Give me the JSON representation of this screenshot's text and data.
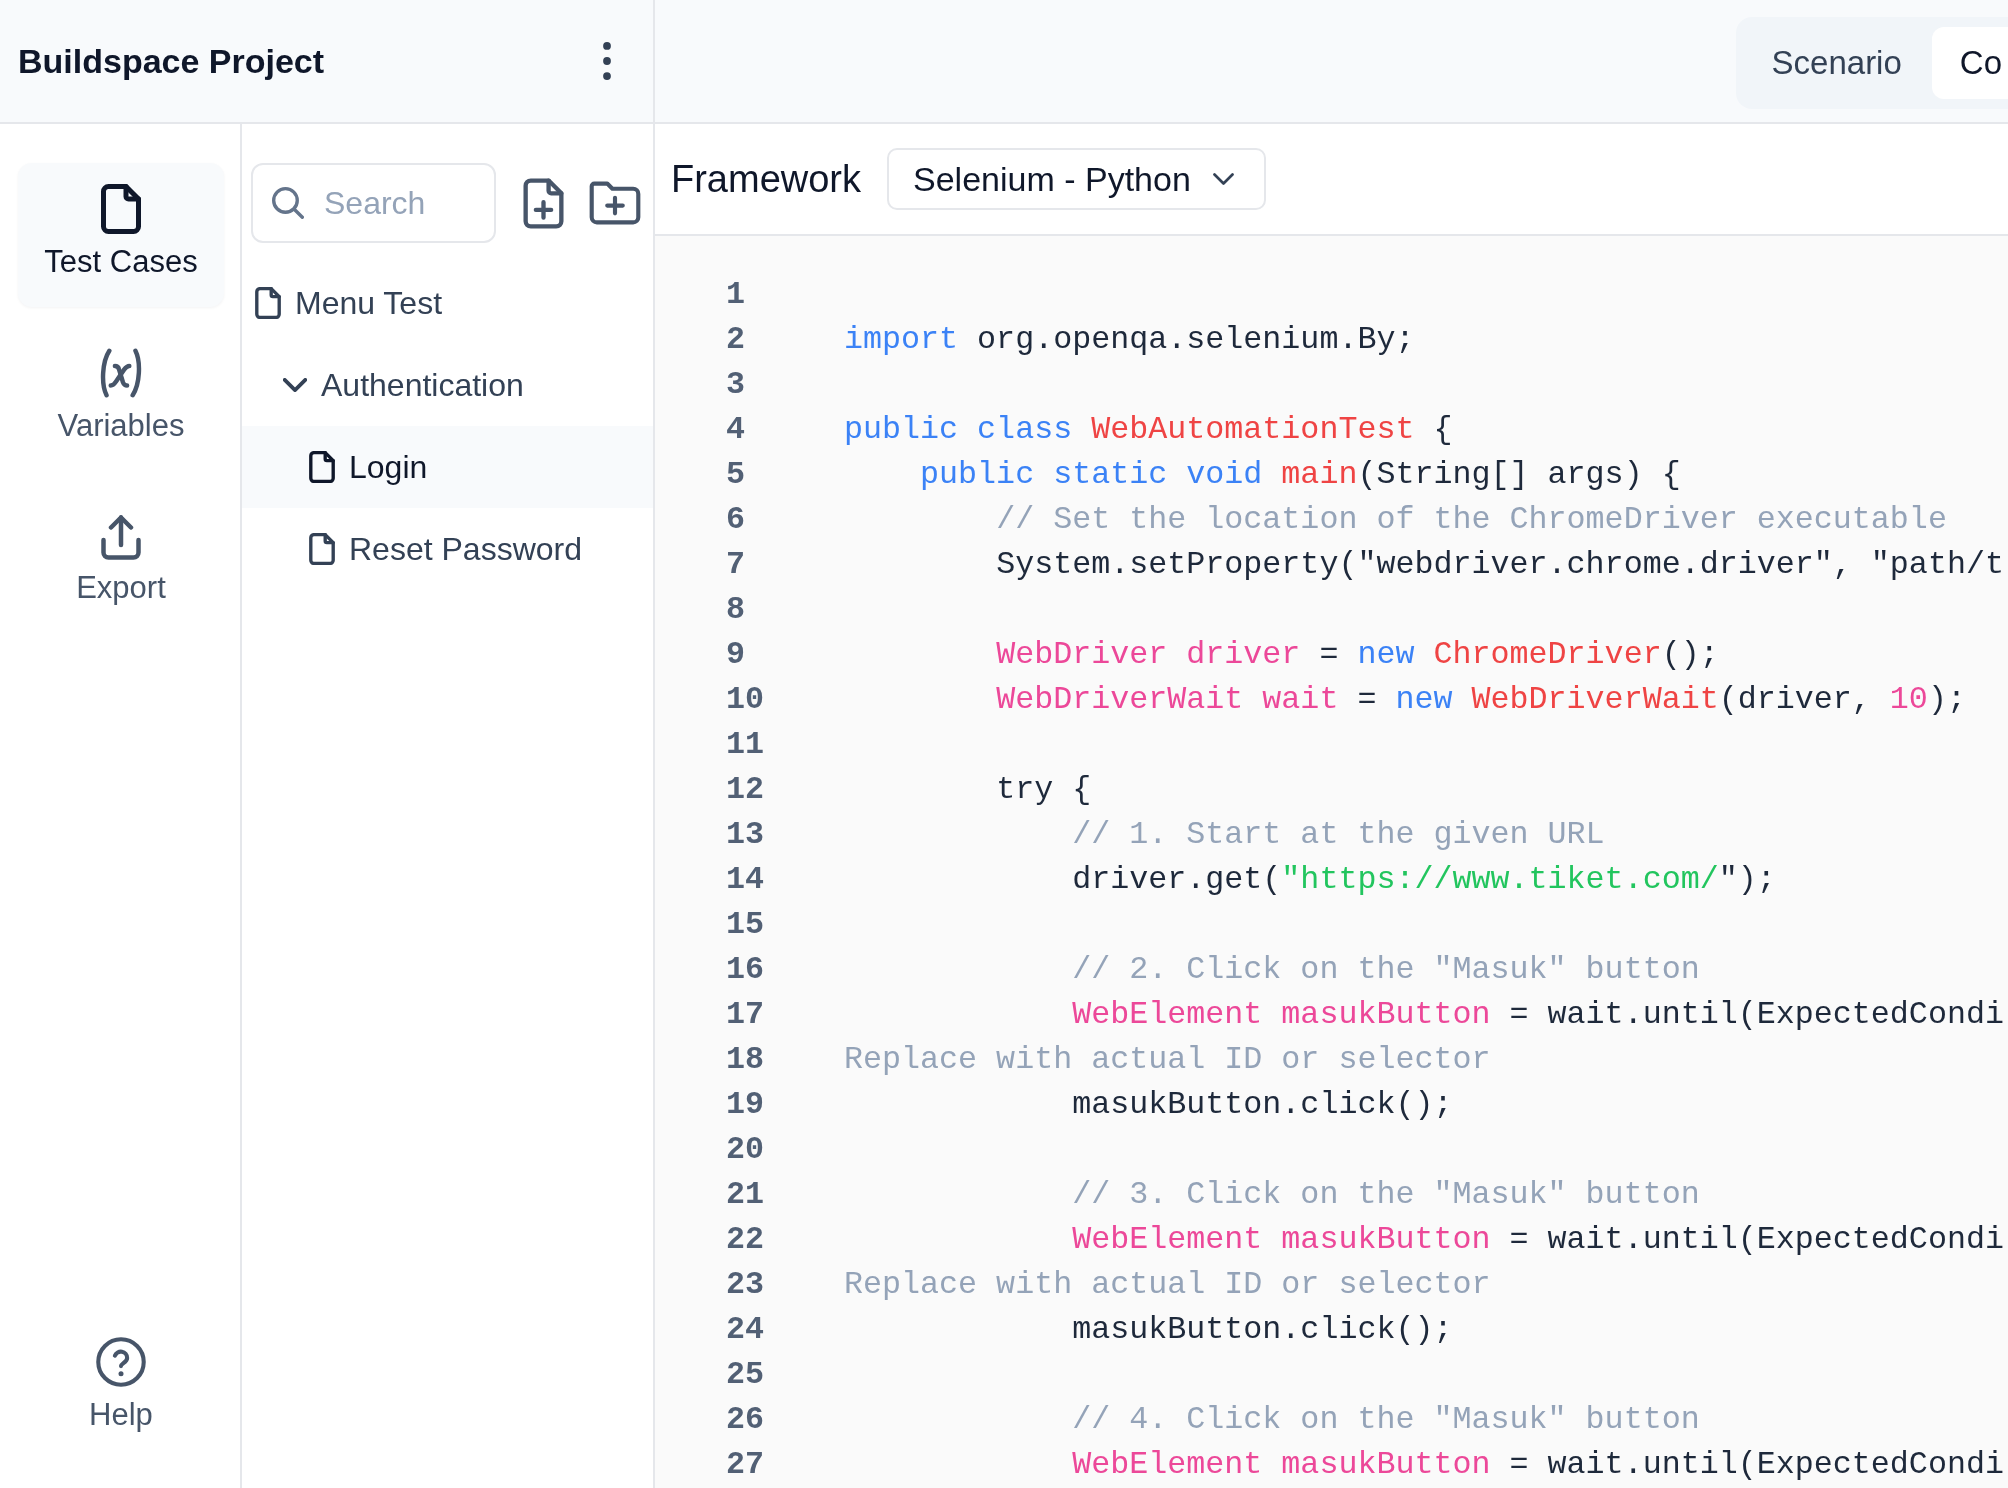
{
  "project": {
    "title": "Buildspace Project"
  },
  "view_tabs": [
    {
      "label": "Scenario",
      "selected": false
    },
    {
      "label": "Co",
      "selected": true
    }
  ],
  "nav": {
    "items": [
      {
        "label": "Test Cases",
        "selected": true
      },
      {
        "label": "Variables",
        "selected": false
      },
      {
        "label": "Export",
        "selected": false
      }
    ],
    "help": {
      "label": "Help"
    }
  },
  "explorer": {
    "search": {
      "placeholder": "Search"
    },
    "tree": [
      {
        "label": "Menu Test",
        "kind": "file",
        "selected": false
      },
      {
        "label": "Authentication",
        "kind": "folder",
        "expanded": true,
        "selected": false,
        "children": [
          {
            "label": "Login",
            "kind": "file",
            "selected": true
          },
          {
            "label": "Reset Password",
            "kind": "file",
            "selected": false
          }
        ]
      }
    ]
  },
  "framework": {
    "label": "Framework",
    "value": "Selenium - Python"
  },
  "code": {
    "lines": [
      {
        "number": "1"
      },
      {
        "number": "2",
        "tokens": [
          {
            "text": "import ",
            "kind": "keyword"
          },
          {
            "text": "org.openqa.selenium.By;",
            "kind": "plain"
          }
        ]
      },
      {
        "number": "3"
      },
      {
        "number": "4",
        "tokens": [
          {
            "text": "public class ",
            "kind": "keyword"
          },
          {
            "text": "WebAutomationTest",
            "kind": "function"
          },
          {
            "text": " {",
            "kind": "plain"
          }
        ]
      },
      {
        "number": "5",
        "tokens": [
          {
            "text": "    public static void ",
            "kind": "keyword"
          },
          {
            "text": "main",
            "kind": "function"
          },
          {
            "text": "(String[] args) {",
            "kind": "plain"
          }
        ]
      },
      {
        "number": "6",
        "tokens": [
          {
            "text": "        // Set the location of the ChromeDriver executable",
            "kind": "comment"
          }
        ]
      },
      {
        "number": "7",
        "tokens": [
          {
            "text": "        System.setProperty(\"webdriver.chrome.driver\", \"path/t",
            "kind": "plain"
          }
        ]
      },
      {
        "number": "8"
      },
      {
        "number": "9",
        "tokens": [
          {
            "text": "        WebDriver driver",
            "kind": "variable"
          },
          {
            "text": " = ",
            "kind": "plain"
          },
          {
            "text": "new ",
            "kind": "keyword"
          },
          {
            "text": "ChromeDriver",
            "kind": "function"
          },
          {
            "text": "();",
            "kind": "plain"
          }
        ]
      },
      {
        "number": "10",
        "tokens": [
          {
            "text": "        WebDriverWait wait",
            "kind": "variable"
          },
          {
            "text": " = ",
            "kind": "plain"
          },
          {
            "text": "new ",
            "kind": "keyword"
          },
          {
            "text": "WebDriverWait",
            "kind": "function"
          },
          {
            "text": "(driver, ",
            "kind": "plain"
          },
          {
            "text": "10",
            "kind": "number"
          },
          {
            "text": ");",
            "kind": "plain"
          }
        ]
      },
      {
        "number": "11"
      },
      {
        "number": "12",
        "tokens": [
          {
            "text": "        try {",
            "kind": "plain"
          }
        ]
      },
      {
        "number": "13",
        "tokens": [
          {
            "text": "            // 1. Start at the given URL",
            "kind": "comment"
          }
        ]
      },
      {
        "number": "14",
        "tokens": [
          {
            "text": "            driver.get(",
            "kind": "plain"
          },
          {
            "text": "\"https://www.tiket.com/",
            "kind": "string"
          },
          {
            "text": "\");",
            "kind": "plain"
          }
        ]
      },
      {
        "number": "15"
      },
      {
        "number": "16",
        "tokens": [
          {
            "text": "            // 2. Click on the \"Masuk\" button",
            "kind": "comment"
          }
        ]
      },
      {
        "number": "17",
        "tokens": [
          {
            "text": "            WebElement masukButton",
            "kind": "variable"
          },
          {
            "text": " = wait.until(ExpectedCondi",
            "kind": "plain"
          }
        ]
      },
      {
        "number": "18",
        "tokens": [
          {
            "text": "Replace with actual ID or selector",
            "kind": "comment"
          }
        ]
      },
      {
        "number": "19",
        "tokens": [
          {
            "text": "            masukButton.click();",
            "kind": "plain"
          }
        ]
      },
      {
        "number": "20"
      },
      {
        "number": "21",
        "tokens": [
          {
            "text": "            // 3. Click on the \"Masuk\" button",
            "kind": "comment"
          }
        ]
      },
      {
        "number": "22",
        "tokens": [
          {
            "text": "            WebElement masukButton",
            "kind": "variable"
          },
          {
            "text": " = wait.until(ExpectedCondi",
            "kind": "plain"
          }
        ]
      },
      {
        "number": "23",
        "tokens": [
          {
            "text": "Replace with actual ID or selector",
            "kind": "comment"
          }
        ]
      },
      {
        "number": "24",
        "tokens": [
          {
            "text": "            masukButton.click();",
            "kind": "plain"
          }
        ]
      },
      {
        "number": "25"
      },
      {
        "number": "26",
        "tokens": [
          {
            "text": "            // 4. Click on the \"Masuk\" button",
            "kind": "comment"
          }
        ]
      },
      {
        "number": "27",
        "tokens": [
          {
            "text": "            WebElement masukButton",
            "kind": "variable"
          },
          {
            "text": " = wait.until(ExpectedCondi",
            "kind": "plain"
          }
        ]
      }
    ]
  }
}
